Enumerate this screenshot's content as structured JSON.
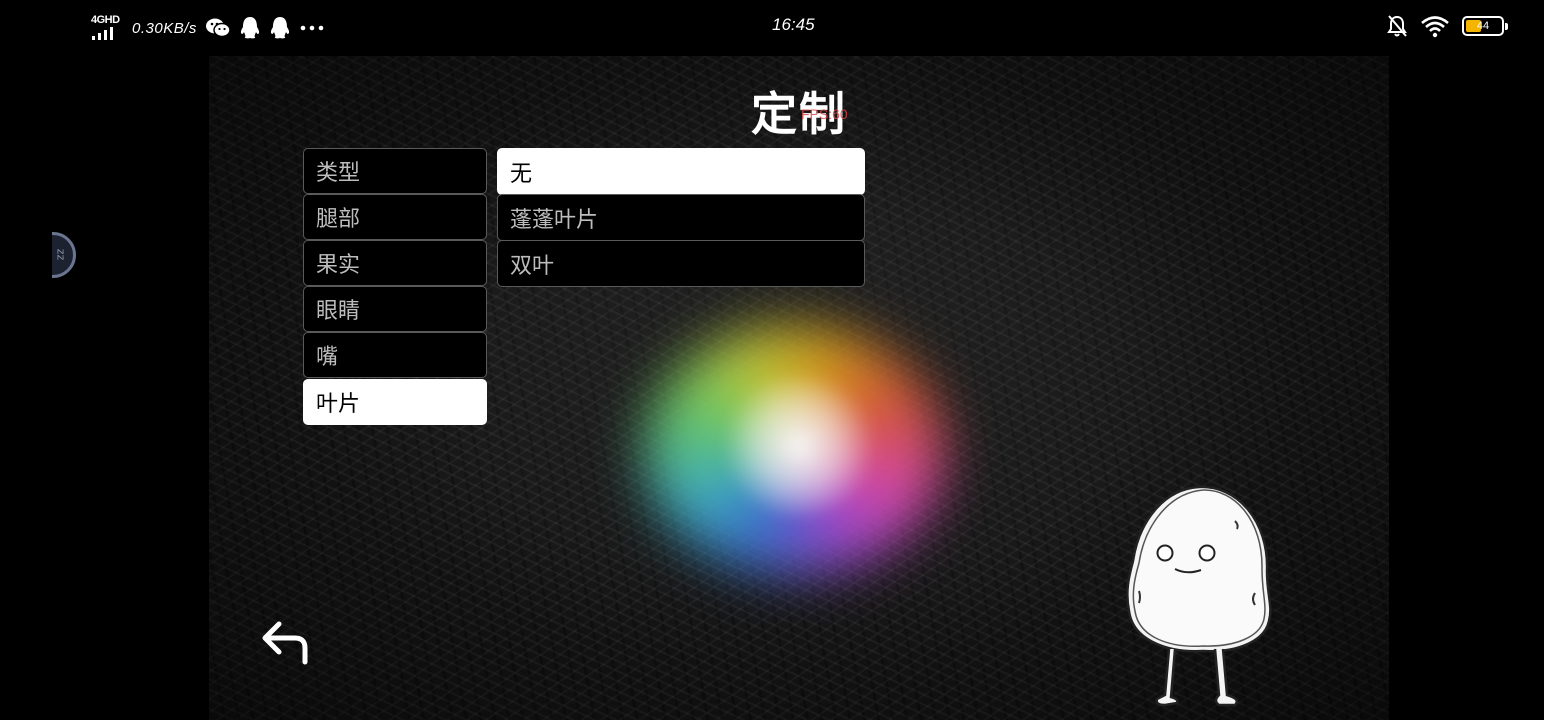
{
  "status_bar": {
    "network_label": "4GHD",
    "speed": "0.30KB/s",
    "time": "16:45",
    "battery_level": "44",
    "battery_fraction": 0.44,
    "left_icons": [
      "wechat-icon",
      "qq-icon",
      "qq-icon",
      "more-dots-icon"
    ],
    "right_icons": [
      "mute-bell-icon",
      "wifi-icon",
      "battery-icon"
    ]
  },
  "game": {
    "title": "定制",
    "fps_text": "FPS:60",
    "categories": [
      {
        "label": "类型",
        "selected": false
      },
      {
        "label": "腿部",
        "selected": false
      },
      {
        "label": "果实",
        "selected": false
      },
      {
        "label": "眼睛",
        "selected": false
      },
      {
        "label": "嘴",
        "selected": false
      },
      {
        "label": "叶片",
        "selected": true
      }
    ],
    "options": [
      {
        "label": "无",
        "selected": true
      },
      {
        "label": "蓬蓬叶片",
        "selected": false
      },
      {
        "label": "双叶",
        "selected": false
      }
    ],
    "back_icon": "back-arrow-icon",
    "accent_selected_bg": "#ffffff",
    "button_bg": "#000000"
  }
}
